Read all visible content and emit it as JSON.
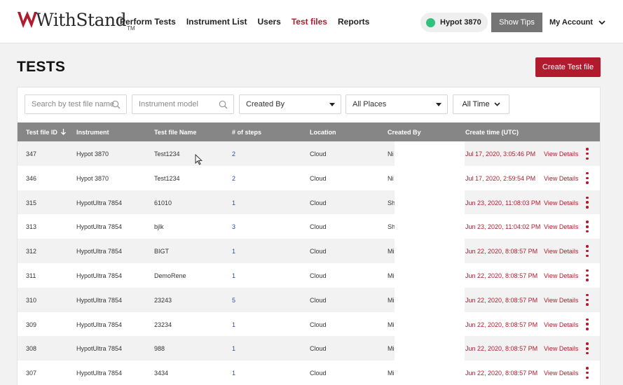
{
  "brand": {
    "name": "WithStand",
    "tm": "TM"
  },
  "nav": [
    {
      "label": "Perform Tests",
      "active": false
    },
    {
      "label": "Instrument List",
      "active": false
    },
    {
      "label": "Users",
      "active": false
    },
    {
      "label": "Test files",
      "active": true
    },
    {
      "label": "Reports",
      "active": false
    }
  ],
  "device": {
    "name": "Hypot 3870",
    "status_color": "#2ec27e"
  },
  "header_buttons": {
    "show_tips": "Show Tips",
    "account": "My Account"
  },
  "page": {
    "title": "TESTS",
    "create_button": "Create Test file"
  },
  "filters": {
    "search_placeholder": "Search by test file name",
    "instrument_placeholder": "Instrument model",
    "created_by": "Created By",
    "places": "All Places",
    "time": "All Time"
  },
  "table": {
    "columns": [
      "Test file ID",
      "Instrument",
      "Test file Name",
      "# of steps",
      "Location",
      "Created By",
      "Create time (UTC)"
    ],
    "view_label": "View Details",
    "rows": [
      {
        "id": "347",
        "instrument": "Hypot 3870",
        "name": "Test1234",
        "steps": "2",
        "location": "Cloud",
        "created_by": "Ni",
        "time": "Jul 17, 2020, 3:05:46 PM"
      },
      {
        "id": "346",
        "instrument": "Hypot 3870",
        "name": "Test1234",
        "steps": "2",
        "location": "Cloud",
        "created_by": "Ni",
        "time": "Jul 17, 2020, 2:59:54 PM"
      },
      {
        "id": "315",
        "instrument": "HypotUltra 7854",
        "name": "61010",
        "steps": "1",
        "location": "Cloud",
        "created_by": "Sh",
        "time": "Jun 23, 2020, 11:08:03 PM"
      },
      {
        "id": "313",
        "instrument": "HypotUltra 7854",
        "name": "bjlk",
        "steps": "3",
        "location": "Cloud",
        "created_by": "Sh",
        "time": "Jun 23, 2020, 11:04:02 PM"
      },
      {
        "id": "312",
        "instrument": "HypotUltra 7854",
        "name": "BIGT",
        "steps": "1",
        "location": "Cloud",
        "created_by": "Mi",
        "time": "Jun 22, 2020, 8:08:57 PM"
      },
      {
        "id": "311",
        "instrument": "HypotUltra 7854",
        "name": "DemoRene",
        "steps": "1",
        "location": "Cloud",
        "created_by": "Mi",
        "time": "Jun 22, 2020, 8:08:57 PM"
      },
      {
        "id": "310",
        "instrument": "HypotUltra 7854",
        "name": "23243",
        "steps": "5",
        "location": "Cloud",
        "created_by": "Mi",
        "time": "Jun 22, 2020, 8:08:57 PM"
      },
      {
        "id": "309",
        "instrument": "HypotUltra 7854",
        "name": "23234",
        "steps": "1",
        "location": "Cloud",
        "created_by": "Mi",
        "time": "Jun 22, 2020, 8:08:57 PM"
      },
      {
        "id": "308",
        "instrument": "HypotUltra 7854",
        "name": "988",
        "steps": "1",
        "location": "Cloud",
        "created_by": "Mi",
        "time": "Jun 22, 2020, 8:08:57 PM"
      },
      {
        "id": "307",
        "instrument": "HypotUltra 7854",
        "name": "3434",
        "steps": "1",
        "location": "Cloud",
        "created_by": "Mi",
        "time": "Jun 22, 2020, 8:08:57 PM"
      }
    ]
  },
  "colors": {
    "brand_red": "#b01c2e",
    "header_gray": "#868686",
    "tips_gray": "#757575"
  }
}
